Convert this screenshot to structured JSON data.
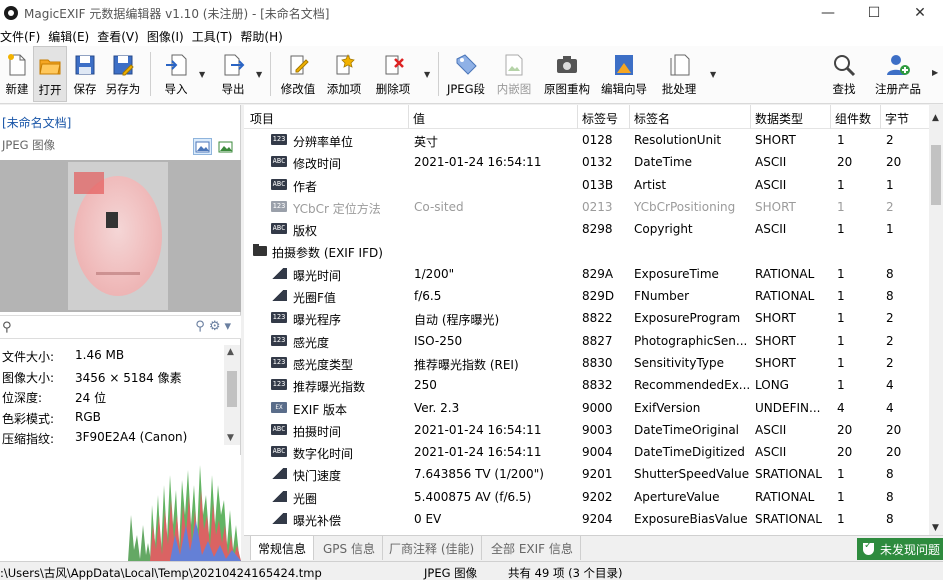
{
  "window": {
    "title": "MagicEXIF 元数据编辑器 v1.10 (未注册) - [未命名文档]",
    "minimize": "—",
    "maximize": "☐",
    "close": "✕"
  },
  "menu": [
    "文件(F)",
    "编辑(E)",
    "查看(V)",
    "图像(I)",
    "工具(T)",
    "帮助(H)"
  ],
  "toolbar": {
    "new": "新建",
    "open": "打开",
    "save": "保存",
    "save_as": "另存为",
    "import": "导入",
    "export": "导出",
    "modify": "修改值",
    "add": "添加项",
    "delete": "删除项",
    "jpeg_seg": "JPEG段",
    "embedded": "内嵌图",
    "rebuild": "原图重构",
    "wizard": "编辑向导",
    "batch": "批处理",
    "find": "查找",
    "register": "注册产品"
  },
  "sidebar": {
    "doc_name": "[未命名文档]",
    "image_type": "JPEG 图像",
    "info": [
      {
        "key": "文件大小:",
        "value": "1.46 MB"
      },
      {
        "key": "图像大小:",
        "value": "3456 × 5184 像素"
      },
      {
        "key": "位深度:",
        "value": "24 位"
      },
      {
        "key": "色彩模式:",
        "value": "RGB"
      },
      {
        "key": "压缩指纹:",
        "value": "3F90E2A4 (Canon)"
      }
    ]
  },
  "table": {
    "headers": [
      "项目",
      "值",
      "标签号",
      "标签名",
      "数据类型",
      "组件数",
      "字节"
    ],
    "rows": [
      {
        "badge": "123",
        "item": "分辨率单位",
        "value": "英寸",
        "tag": "0128",
        "name": "ResolutionUnit",
        "type": "SHORT",
        "count": "1",
        "bytes": "2",
        "dim": false
      },
      {
        "badge": "ABC",
        "item": "修改时间",
        "value": "2021-01-24 16:54:11",
        "tag": "0132",
        "name": "DateTime",
        "type": "ASCII",
        "count": "20",
        "bytes": "20",
        "dim": false
      },
      {
        "badge": "ABC",
        "item": "作者",
        "value": "",
        "tag": "013B",
        "name": "Artist",
        "type": "ASCII",
        "count": "1",
        "bytes": "1",
        "dim": false
      },
      {
        "badge": "123",
        "item": "YCbCr 定位方法",
        "value": "Co-sited",
        "tag": "0213",
        "name": "YCbCrPositioning",
        "type": "SHORT",
        "count": "1",
        "bytes": "2",
        "dim": true
      },
      {
        "badge": "ABC",
        "item": "版权",
        "value": "",
        "tag": "8298",
        "name": "Copyright",
        "type": "ASCII",
        "count": "1",
        "bytes": "1",
        "dim": false
      },
      {
        "group": true,
        "item": "拍摄参数 (EXIF IFD)"
      },
      {
        "badge": "ratio",
        "item": "曝光时间",
        "value": "1/200\"",
        "tag": "829A",
        "name": "ExposureTime",
        "type": "RATIONAL",
        "count": "1",
        "bytes": "8",
        "dim": false
      },
      {
        "badge": "ratio",
        "item": "光圈F值",
        "value": "f/6.5",
        "tag": "829D",
        "name": "FNumber",
        "type": "RATIONAL",
        "count": "1",
        "bytes": "8",
        "dim": false
      },
      {
        "badge": "123",
        "item": "曝光程序",
        "value": "自动 (程序曝光)",
        "tag": "8822",
        "name": "ExposureProgram",
        "type": "SHORT",
        "count": "1",
        "bytes": "2",
        "dim": false
      },
      {
        "badge": "123",
        "item": "感光度",
        "value": "ISO-250",
        "tag": "8827",
        "name": "PhotographicSen...",
        "type": "SHORT",
        "count": "1",
        "bytes": "2",
        "dim": false
      },
      {
        "badge": "123",
        "item": "感光度类型",
        "value": "推荐曝光指数 (REI)",
        "tag": "8830",
        "name": "SensitivityType",
        "type": "SHORT",
        "count": "1",
        "bytes": "2",
        "dim": false
      },
      {
        "badge": "123",
        "item": "推荐曝光指数",
        "value": "250",
        "tag": "8832",
        "name": "RecommendedEx...",
        "type": "LONG",
        "count": "1",
        "bytes": "4",
        "dim": false
      },
      {
        "badge": "EX",
        "item": "EXIF 版本",
        "value": "Ver. 2.3",
        "tag": "9000",
        "name": "ExifVersion",
        "type": "UNDEFIN...",
        "count": "4",
        "bytes": "4",
        "dim": false
      },
      {
        "badge": "ABC",
        "item": "拍摄时间",
        "value": "2021-01-24 16:54:11",
        "tag": "9003",
        "name": "DateTimeOriginal",
        "type": "ASCII",
        "count": "20",
        "bytes": "20",
        "dim": false
      },
      {
        "badge": "ABC",
        "item": "数字化时间",
        "value": "2021-01-24 16:54:11",
        "tag": "9004",
        "name": "DateTimeDigitized",
        "type": "ASCII",
        "count": "20",
        "bytes": "20",
        "dim": false
      },
      {
        "badge": "ratio",
        "item": "快门速度",
        "value": "7.643856 TV (1/200\")",
        "tag": "9201",
        "name": "ShutterSpeedValue",
        "type": "SRATIONAL",
        "count": "1",
        "bytes": "8",
        "dim": false
      },
      {
        "badge": "ratio",
        "item": "光圈",
        "value": "5.400875 AV (f/6.5)",
        "tag": "9202",
        "name": "ApertureValue",
        "type": "RATIONAL",
        "count": "1",
        "bytes": "8",
        "dim": false
      },
      {
        "badge": "ratio",
        "item": "曝光补偿",
        "value": "0 EV",
        "tag": "9204",
        "name": "ExposureBiasValue",
        "type": "SRATIONAL",
        "count": "1",
        "bytes": "8",
        "dim": false
      }
    ]
  },
  "tabs": [
    "常规信息",
    "GPS 信息",
    "厂商注释 (佳能)",
    "全部 EXIF 信息"
  ],
  "no_defect": "未发现问题",
  "status": {
    "path": ":\\Users\\古风\\AppData\\Local\\Temp\\20210424165424.tmp",
    "type": "JPEG 图像",
    "count": "共有 49 项 (3 个目录)"
  },
  "colors": {
    "accent_link": "#1a56a8",
    "ok_green": "#2e8b3e",
    "badge_dark": "#333a48"
  }
}
